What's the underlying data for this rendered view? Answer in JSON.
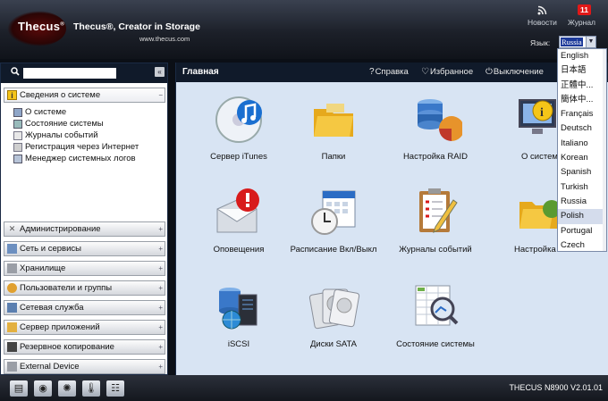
{
  "header": {
    "logo_text": "Thecus",
    "tagline": "Thecus®, Creator in Storage",
    "url": "www.thecus.com",
    "news_label": "Новости",
    "journal_label": "Журнал",
    "journal_badge": "11",
    "language_label": "Язык:",
    "language_value": "Russia"
  },
  "language_options": [
    "English",
    "日本語",
    "正體中...",
    "簡体中...",
    "Français",
    "Deutsch",
    "Italiano",
    "Korean",
    "Spanish",
    "Turkish",
    "Russia",
    "Polish",
    "Portugal",
    "Czech"
  ],
  "language_highlighted": "Polish",
  "sidebar": {
    "search_placeholder": "",
    "sections": [
      {
        "label": "Сведения о системе",
        "icon": "info-icon",
        "open": true
      },
      {
        "label": "Администрирование",
        "icon": "tools-icon"
      },
      {
        "label": "Сеть и сервисы",
        "icon": "network-icon"
      },
      {
        "label": "Хранилище",
        "icon": "storage-icon"
      },
      {
        "label": "Пользователи и группы",
        "icon": "users-icon"
      },
      {
        "label": "Сетевая служба",
        "icon": "network-service-icon"
      },
      {
        "label": "Сервер приложений",
        "icon": "app-server-icon"
      },
      {
        "label": "Резервное копирование",
        "icon": "backup-icon"
      },
      {
        "label": "External Device",
        "icon": "external-device-icon"
      }
    ],
    "tree_items": [
      {
        "label": "О системе",
        "icon": "about-icon"
      },
      {
        "label": "Состояние системы",
        "icon": "status-icon"
      },
      {
        "label": "Журналы событий",
        "icon": "log-icon"
      },
      {
        "label": "Регистрация через Интернет",
        "icon": "register-icon"
      },
      {
        "label": "Менеджер системных логов",
        "icon": "syslog-icon"
      }
    ]
  },
  "main": {
    "title": "Главная",
    "help": "Справка",
    "favorites": "Избранное",
    "shutdown": "Выключение",
    "tiles": [
      {
        "label": "Сервер iTunes",
        "icon": "itunes-icon"
      },
      {
        "label": "Папки",
        "icon": "folders-icon"
      },
      {
        "label": "Настройка RAID",
        "icon": "raid-icon"
      },
      {
        "label": "О систем",
        "icon": "about-system-icon"
      },
      {
        "label": "Оповещения",
        "icon": "notification-icon"
      },
      {
        "label": "Расписание Вкл/Выкл",
        "icon": "schedule-icon"
      },
      {
        "label": "Журналы событий",
        "icon": "event-log-icon"
      },
      {
        "label": "Настройка Е",
        "icon": "setup-icon"
      },
      {
        "label": "iSCSI",
        "icon": "iscsi-icon"
      },
      {
        "label": "Диски SATA",
        "icon": "sata-disks-icon"
      },
      {
        "label": "Состояние системы",
        "icon": "system-status-icon"
      }
    ]
  },
  "footer": {
    "model": "THECUS N8900 V2.01.01",
    "icons": [
      "disk-icon",
      "cd-icon",
      "fan-icon",
      "thermometer-icon",
      "network-icon"
    ]
  }
}
